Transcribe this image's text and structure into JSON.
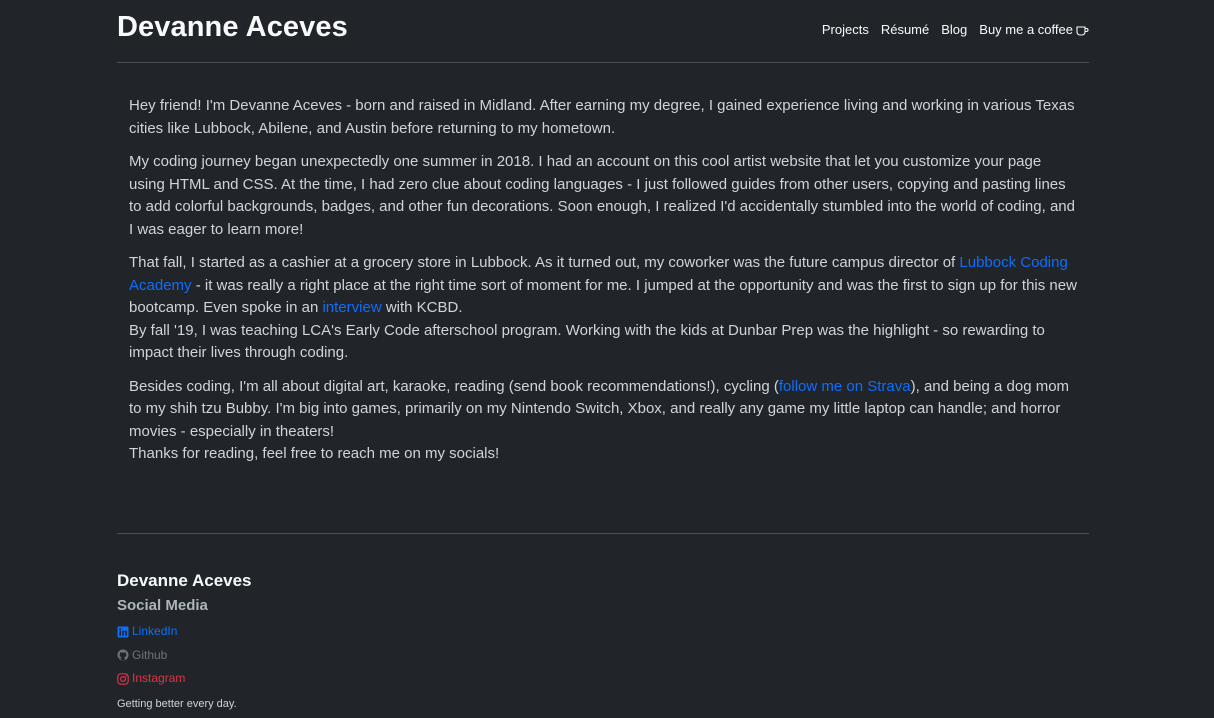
{
  "header": {
    "brand": "Devanne Aceves",
    "nav": [
      {
        "label": "Projects"
      },
      {
        "label": "Résumé"
      },
      {
        "label": "Blog"
      },
      {
        "label": "Buy me a coffee",
        "icon": "coffee-cup-icon"
      }
    ]
  },
  "main": {
    "p1": "Hey friend! I'm Devanne Aceves - born and raised in Midland. After earning my degree, I gained experience living and working in various Texas cities like Lubbock, Abilene, and Austin before returning to my hometown.",
    "p2": "My coding journey began unexpectedly one summer in 2018. I had an account on this cool artist website that let you customize your page using HTML and CSS. At the time, I had zero clue about coding languages - I just followed guides from other users, copying and pasting lines to add colorful backgrounds, badges, and other fun decorations. Soon enough, I realized I'd accidentally stumbled into the world of coding, and I was eager to learn more!",
    "p3_a": "That fall, I started as a cashier at a grocery store in Lubbock. As it turned out, my coworker was the future campus director of ",
    "p3_link1": "Lubbock Coding Academy",
    "p3_b": " - it was really a right place at the right time sort of moment for me. I jumped at the opportunity and was the first to sign up for this new bootcamp. Even spoke in an ",
    "p3_link2": "interview",
    "p3_c": " with KCBD.",
    "p3_d": "By fall '19, I was teaching LCA's Early Code afterschool program. Working with the kids at Dunbar Prep was the highlight - so rewarding to impact their lives through coding.",
    "p4_a": "Besides coding, I'm all about digital art, karaoke, reading (send book recommendations!), cycling (",
    "p4_link": "follow me on Strava",
    "p4_b": "), and being a dog mom to my shih tzu Bubby. I'm big into games, primarily on my Nintendo Switch, Xbox, and really any game my little laptop can handle; and horror movies - especially in theaters!",
    "p4_c": "Thanks for reading, feel free to reach me on my socials!"
  },
  "footer": {
    "name": "Devanne Aceves",
    "social_heading": "Social Media",
    "socials": [
      {
        "label": "LinkedIn",
        "icon": "linkedin-icon",
        "color": "#0d6efd"
      },
      {
        "label": "Github",
        "icon": "github-icon",
        "color": "#6c757d"
      },
      {
        "label": "Instagram",
        "icon": "instagram-icon",
        "color": "#dc3545"
      }
    ],
    "tagline": "Getting better every day."
  },
  "colors": {
    "background": "#212529",
    "link": "#0d6efd",
    "text": "#ced4da"
  }
}
